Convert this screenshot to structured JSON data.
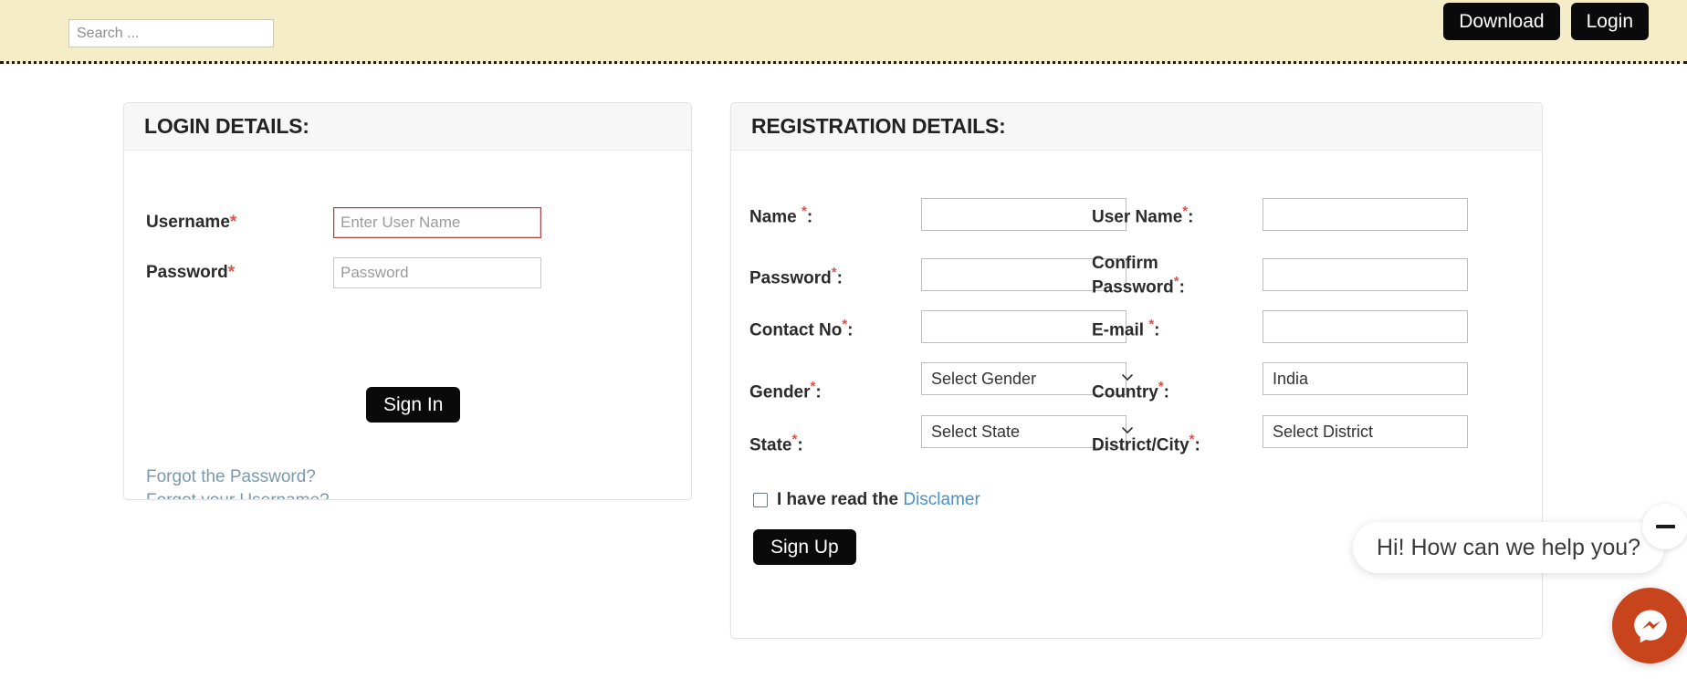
{
  "topbar": {
    "search": {
      "placeholder": "Search ...",
      "value": ""
    },
    "download_label": "Download",
    "login_label": "Login",
    "bg_color": "#f5edc8",
    "button_color": "#0a0a0a"
  },
  "login_panel": {
    "title": "LOGIN DETAILS:",
    "username": {
      "label": "Username",
      "required_marker": "*",
      "placeholder": "Enter User Name",
      "value": "",
      "focused": true,
      "focus_border_color": "#a94442"
    },
    "password": {
      "label": "Password",
      "required_marker": "*",
      "placeholder": "Password",
      "value": ""
    },
    "signin_label": "Sign In",
    "forgot_password_label": "Forgot the Password?",
    "forgot_username_label": "Forgot your Username?",
    "link_color": "#7a99ac"
  },
  "registration_panel": {
    "title": "REGISTRATION DETAILS:",
    "fields": {
      "name": {
        "label": "Name ",
        "required_marker": "*",
        "suffix": ":",
        "value": "",
        "type": "text"
      },
      "user_name": {
        "label": "User Name",
        "required_marker": "*",
        "suffix": ":",
        "value": "",
        "type": "text"
      },
      "password": {
        "label": "Password",
        "required_marker": "*",
        "suffix": ":",
        "value": "",
        "type": "password"
      },
      "confirm_password": {
        "label": "Confirm Password",
        "required_marker": "*",
        "suffix": ":",
        "value": "",
        "type": "password"
      },
      "contact_no": {
        "label": "Contact No",
        "required_marker": "*",
        "suffix": ":",
        "value": "",
        "type": "text"
      },
      "email": {
        "label": "E-mail ",
        "required_marker": "*",
        "suffix": ":",
        "value": "",
        "type": "text"
      },
      "gender": {
        "label": "Gender",
        "required_marker": "*",
        "suffix": ":",
        "value": "Select Gender",
        "type": "select"
      },
      "country": {
        "label": "Country",
        "required_marker": "*",
        "suffix": ":",
        "value": "India",
        "type": "select"
      },
      "state": {
        "label": "State",
        "required_marker": "*",
        "suffix": ":",
        "value": "Select State",
        "type": "select"
      },
      "district_city": {
        "label": "District/City",
        "required_marker": "*",
        "suffix": ":",
        "value": "Select District",
        "type": "select"
      }
    },
    "disclaimer": {
      "checked": false,
      "text": "I have read the",
      "link_label": "Disclamer",
      "link_color": "#4a8fc4"
    },
    "signup_label": "Sign Up"
  },
  "chat_widget": {
    "greeting": "Hi! How can we help you?",
    "fab_color": "#c8441d",
    "minimize_icon": "minus-icon",
    "messenger_icon": "messenger-icon"
  }
}
